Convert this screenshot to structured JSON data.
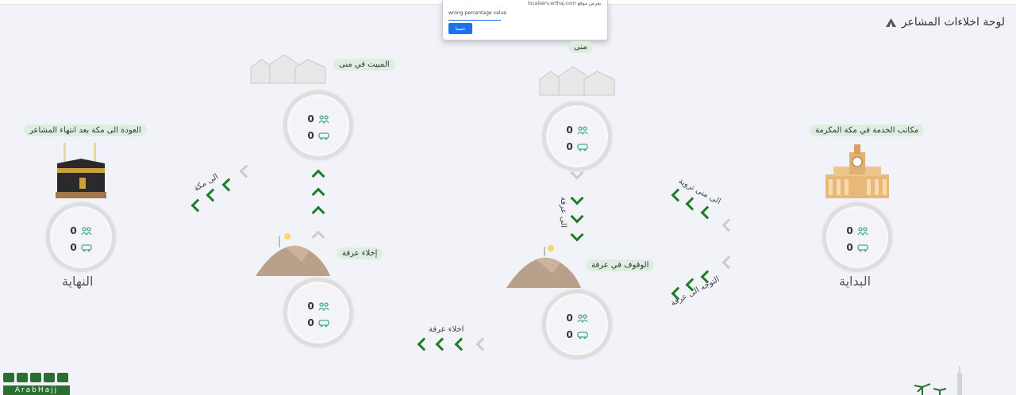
{
  "dialog": {
    "origin": "يعرض موقع localserv.arthaj.com",
    "message": "wrong percentage value",
    "ok_label": "حسنا"
  },
  "page": {
    "title": "لوحة اخلاءات المشاعر"
  },
  "stations": {
    "start": {
      "label": "مكاتب الخدمة في مكة المكرمة",
      "title": "البداية",
      "pilgrims": "0",
      "buses": "0"
    },
    "mina": {
      "label": "منى",
      "pilgrims": "0",
      "buses": "0"
    },
    "arafat": {
      "label": "الوقوف في عرفة",
      "pilgrims": "0",
      "buses": "0"
    },
    "arafat_evac": {
      "label": "إخلاء عرفة",
      "pilgrims": "0",
      "buses": "0"
    },
    "mina_stay": {
      "label": "المبيت في منى",
      "pilgrims": "0",
      "buses": "0"
    },
    "end": {
      "label": "العودة الى مكة بعد انتهاء المشاعر",
      "title": "النهاية",
      "pilgrims": "0",
      "buses": "0"
    }
  },
  "routes": {
    "to_mina_tarwiya": "الى منى تروية",
    "to_arafat": "التوجه الى عرفة",
    "mina_to_arafat": "الى عرفة",
    "arafat_evacuation": "اخلاء عرفة",
    "to_makkah": "الى مكة"
  },
  "brand": {
    "name": "ArabHajj"
  },
  "icons": {
    "pilgrims": "group-of-people-icon",
    "buses": "bus-icon",
    "title": "tent-icon"
  },
  "colors": {
    "accent": "#1e7d2a",
    "label_bg": "#ddeee0",
    "background": "#f1f3f9"
  }
}
